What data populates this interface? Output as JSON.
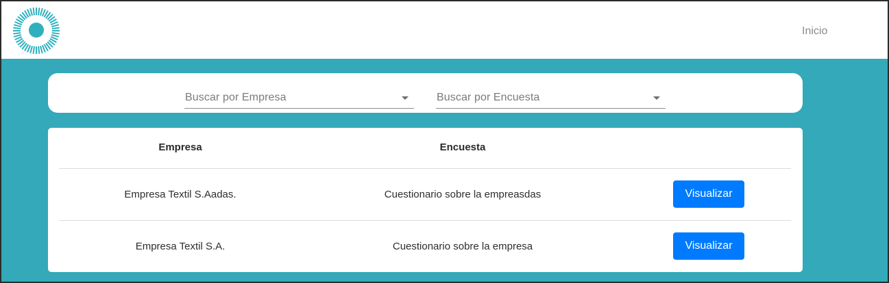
{
  "navbar": {
    "logo_name": "sunburst-logo",
    "brand_color": "#2eb0bd",
    "links": [
      {
        "label": "Inicio"
      }
    ]
  },
  "filters": {
    "empresa": {
      "placeholder": "Buscar por Empresa",
      "icon": "chevron-down-icon"
    },
    "encuesta": {
      "placeholder": "Buscar por Encuesta",
      "icon": "chevron-down-icon"
    }
  },
  "table": {
    "headers": [
      "Empresa",
      "Encuesta",
      ""
    ],
    "rows": [
      {
        "empresa": "Empresa Textil S.Aadas.",
        "encuesta": "Cuestionario sobre la empreasdas",
        "action": "Visualizar"
      },
      {
        "empresa": "Empresa Textil S.A.",
        "encuesta": "Cuestionario sobre la empresa",
        "action": "Visualizar"
      }
    ]
  },
  "colors": {
    "background": "#33a9ba",
    "button": "#007bff",
    "card": "#ffffff"
  }
}
